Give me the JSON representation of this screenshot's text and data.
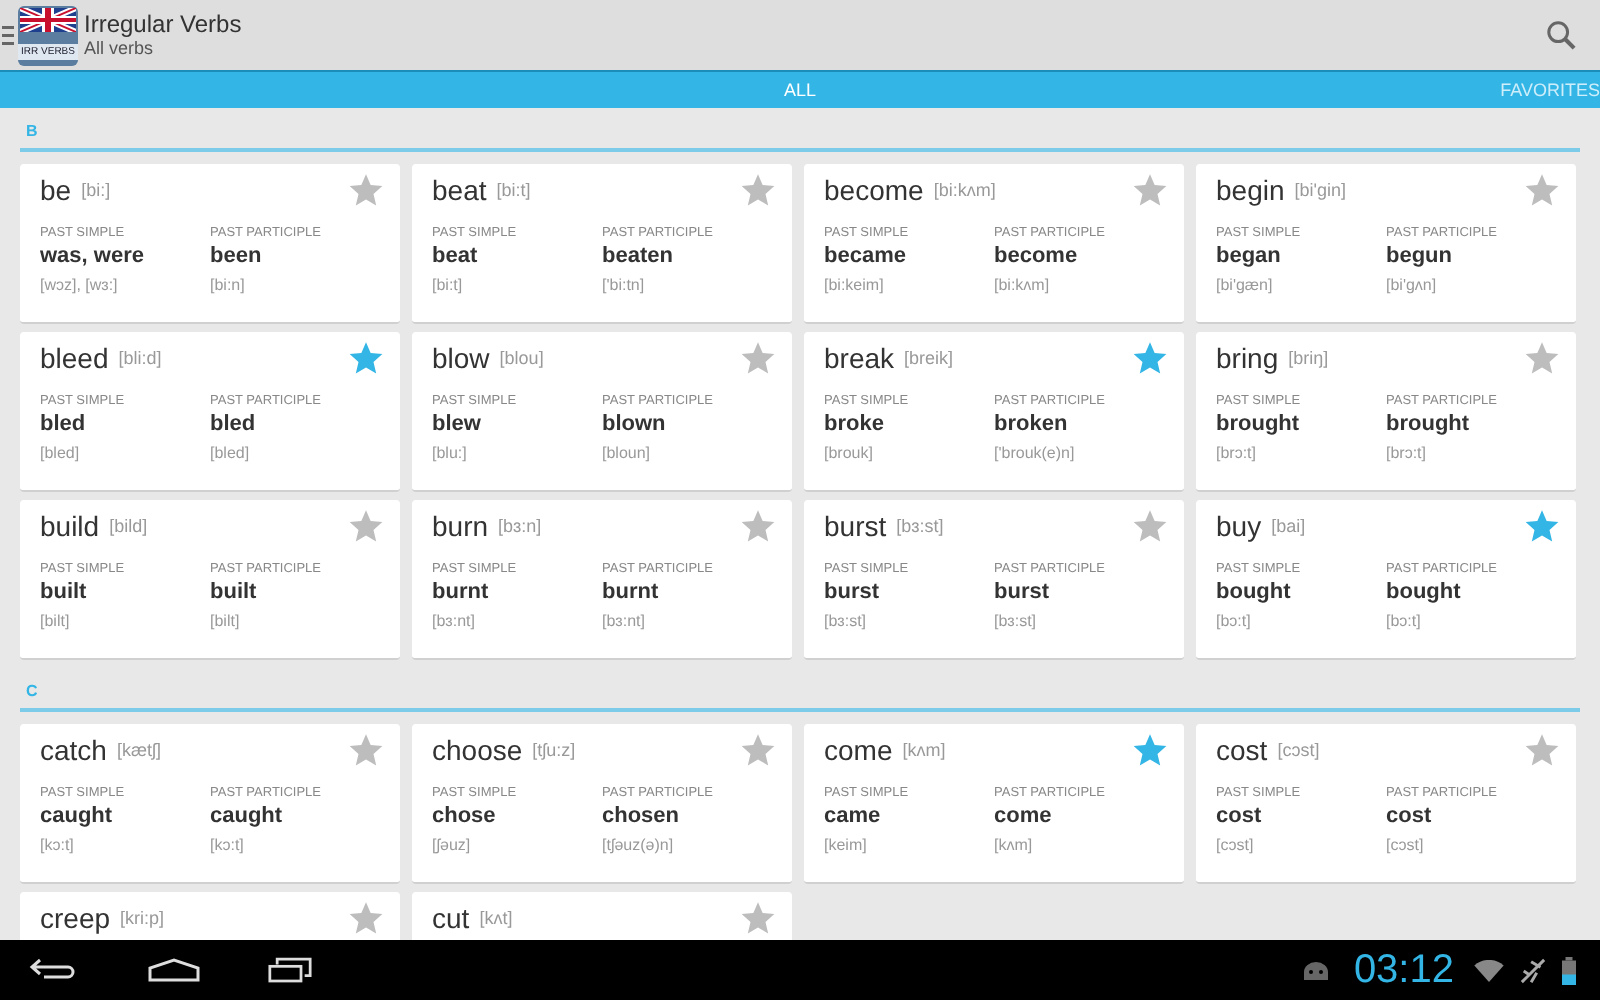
{
  "app": {
    "title": "Irregular Verbs",
    "subtitle": "All verbs",
    "logo_text": "IRR VERBS"
  },
  "tabs": [
    {
      "label": "ALL",
      "selected": true
    },
    {
      "label": "FAVORITES",
      "selected": false
    }
  ],
  "sections": [
    {
      "letter": "B",
      "verbs": [
        {
          "word": "be",
          "phonetic": "[bi:]",
          "favorite": false,
          "past_simple_label": "PAST SIMPLE",
          "past_simple": "was, were",
          "past_simple_phonetic": "[wɔz], [wɜ:]",
          "past_participle_label": "PAST PARTICIPLE",
          "past_participle": "been",
          "past_participle_phonetic": "[bi:n]"
        },
        {
          "word": "beat",
          "phonetic": "[bi:t]",
          "favorite": false,
          "past_simple_label": "PAST SIMPLE",
          "past_simple": "beat",
          "past_simple_phonetic": "[bi:t]",
          "past_participle_label": "PAST PARTICIPLE",
          "past_participle": "beaten",
          "past_participle_phonetic": "['bi:tn]"
        },
        {
          "word": "become",
          "phonetic": "[bi:kʌm]",
          "favorite": false,
          "past_simple_label": "PAST SIMPLE",
          "past_simple": "became",
          "past_simple_phonetic": "[bi:keim]",
          "past_participle_label": "PAST PARTICIPLE",
          "past_participle": "become",
          "past_participle_phonetic": "[bi:kʌm]"
        },
        {
          "word": "begin",
          "phonetic": "[bi'gin]",
          "favorite": false,
          "past_simple_label": "PAST SIMPLE",
          "past_simple": "began",
          "past_simple_phonetic": "[bi'gæn]",
          "past_participle_label": "PAST PARTICIPLE",
          "past_participle": "begun",
          "past_participle_phonetic": "[bi'gʌn]"
        },
        {
          "word": "bleed",
          "phonetic": "[bli:d]",
          "favorite": true,
          "past_simple_label": "PAST SIMPLE",
          "past_simple": "bled",
          "past_simple_phonetic": "[bled]",
          "past_participle_label": "PAST PARTICIPLE",
          "past_participle": "bled",
          "past_participle_phonetic": "[bled]"
        },
        {
          "word": "blow",
          "phonetic": "[blou]",
          "favorite": false,
          "past_simple_label": "PAST SIMPLE",
          "past_simple": "blew",
          "past_simple_phonetic": "[blu:]",
          "past_participle_label": "PAST PARTICIPLE",
          "past_participle": "blown",
          "past_participle_phonetic": "[bloun]"
        },
        {
          "word": "break",
          "phonetic": "[breik]",
          "favorite": true,
          "past_simple_label": "PAST SIMPLE",
          "past_simple": "broke",
          "past_simple_phonetic": "[brouk]",
          "past_participle_label": "PAST PARTICIPLE",
          "past_participle": "broken",
          "past_participle_phonetic": "['brouk(e)n]"
        },
        {
          "word": "bring",
          "phonetic": "[briŋ]",
          "favorite": false,
          "past_simple_label": "PAST SIMPLE",
          "past_simple": "brought",
          "past_simple_phonetic": "[brɔ:t]",
          "past_participle_label": "PAST PARTICIPLE",
          "past_participle": "brought",
          "past_participle_phonetic": "[brɔ:t]"
        },
        {
          "word": "build",
          "phonetic": "[bild]",
          "favorite": false,
          "past_simple_label": "PAST SIMPLE",
          "past_simple": "built",
          "past_simple_phonetic": "[bilt]",
          "past_participle_label": "PAST PARTICIPLE",
          "past_participle": "built",
          "past_participle_phonetic": "[bilt]"
        },
        {
          "word": "burn",
          "phonetic": "[bɜ:n]",
          "favorite": false,
          "past_simple_label": "PAST SIMPLE",
          "past_simple": "burnt",
          "past_simple_phonetic": "[bɜ:nt]",
          "past_participle_label": "PAST PARTICIPLE",
          "past_participle": "burnt",
          "past_participle_phonetic": "[bɜ:nt]"
        },
        {
          "word": "burst",
          "phonetic": "[bɜ:st]",
          "favorite": false,
          "past_simple_label": "PAST SIMPLE",
          "past_simple": "burst",
          "past_simple_phonetic": "[bɜ:st]",
          "past_participle_label": "PAST PARTICIPLE",
          "past_participle": "burst",
          "past_participle_phonetic": "[bɜ:st]"
        },
        {
          "word": "buy",
          "phonetic": "[bai]",
          "favorite": true,
          "past_simple_label": "PAST SIMPLE",
          "past_simple": "bought",
          "past_simple_phonetic": "[bɔ:t]",
          "past_participle_label": "PAST PARTICIPLE",
          "past_participle": "bought",
          "past_participle_phonetic": "[bɔ:t]"
        }
      ]
    },
    {
      "letter": "C",
      "verbs": [
        {
          "word": "catch",
          "phonetic": "[kætʃ]",
          "favorite": false,
          "past_simple_label": "PAST SIMPLE",
          "past_simple": "caught",
          "past_simple_phonetic": "[kɔ:t]",
          "past_participle_label": "PAST PARTICIPLE",
          "past_participle": "caught",
          "past_participle_phonetic": "[kɔ:t]"
        },
        {
          "word": "choose",
          "phonetic": "[tʃu:z]",
          "favorite": false,
          "past_simple_label": "PAST SIMPLE",
          "past_simple": "chose",
          "past_simple_phonetic": "[ʃəuz]",
          "past_participle_label": "PAST PARTICIPLE",
          "past_participle": "chosen",
          "past_participle_phonetic": "[tʃəuz(ə)n]"
        },
        {
          "word": "come",
          "phonetic": "[kʌm]",
          "favorite": true,
          "past_simple_label": "PAST SIMPLE",
          "past_simple": "came",
          "past_simple_phonetic": "[keim]",
          "past_participle_label": "PAST PARTICIPLE",
          "past_participle": "come",
          "past_participle_phonetic": "[kʌm]"
        },
        {
          "word": "cost",
          "phonetic": "[cɔst]",
          "favorite": false,
          "past_simple_label": "PAST SIMPLE",
          "past_simple": "cost",
          "past_simple_phonetic": "[cɔst]",
          "past_participle_label": "PAST PARTICIPLE",
          "past_participle": "cost",
          "past_participle_phonetic": "[cɔst]"
        },
        {
          "word": "creep",
          "phonetic": "[kri:p]",
          "favorite": false
        },
        {
          "word": "cut",
          "phonetic": "[kʌt]",
          "favorite": false
        }
      ]
    }
  ],
  "status_bar": {
    "time": "03:12"
  }
}
